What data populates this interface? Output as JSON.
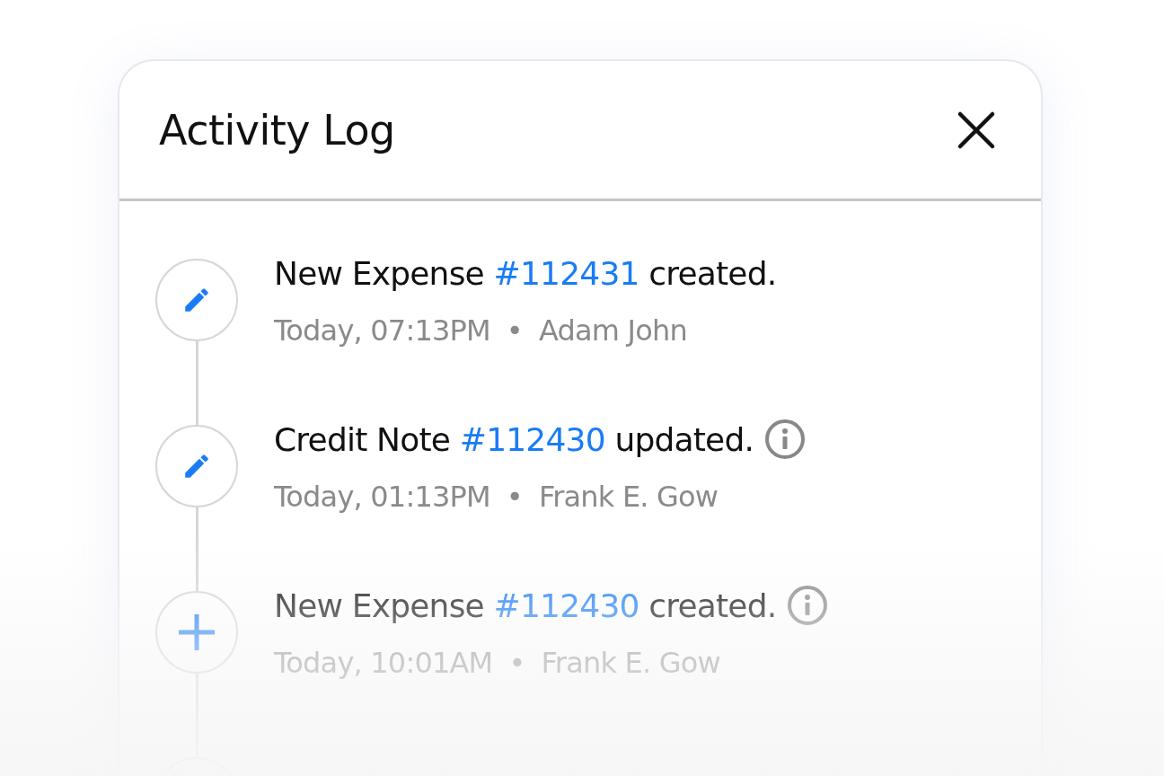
{
  "panel": {
    "title": "Activity Log"
  },
  "entries": [
    {
      "kind": "edit",
      "text_before": "New Expense",
      "link": "#112431",
      "text_after": "created.",
      "info": false,
      "time": "Today, 07:13PM",
      "separator": "•",
      "author": "Adam John"
    },
    {
      "kind": "edit",
      "text_before": "Credit Note",
      "link": "#112430",
      "text_after": "updated.",
      "info": true,
      "time": "Today, 01:13PM",
      "separator": "•",
      "author": "Frank E. Gow"
    },
    {
      "kind": "add",
      "text_before": "New Expense",
      "link": "#112430",
      "text_after": "created.",
      "info": true,
      "time": "Today, 10:01AM",
      "separator": "•",
      "author": "Frank E. Gow"
    }
  ]
}
